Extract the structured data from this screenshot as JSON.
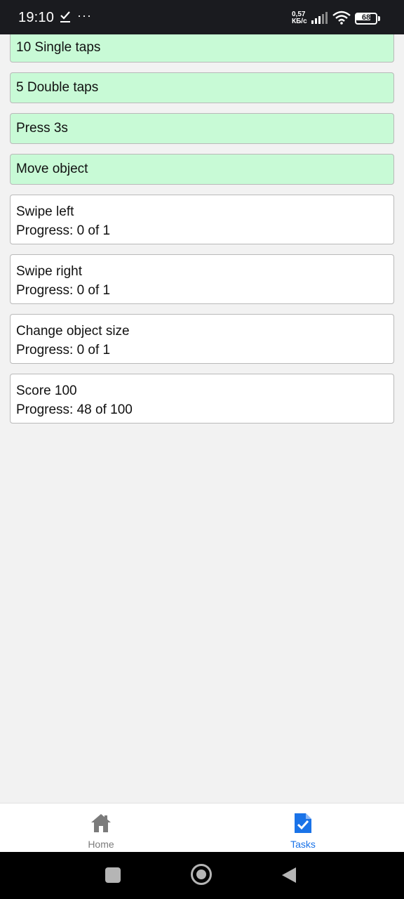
{
  "status_bar": {
    "time": "19:10",
    "check_icon": "download-done-icon",
    "dots": "···",
    "net_speed_value": "0,57",
    "net_speed_unit": "КБ/с",
    "battery": "68"
  },
  "tasks": {
    "completed": [
      {
        "label": "10 Single taps"
      },
      {
        "label": "5 Double taps"
      },
      {
        "label": "Press 3s"
      },
      {
        "label": "Move object"
      }
    ],
    "pending": [
      {
        "label": "Swipe left",
        "progress": "Progress: 0 of 1"
      },
      {
        "label": "Swipe right",
        "progress": "Progress: 0 of 1"
      },
      {
        "label": "Change object size",
        "progress": "Progress: 0 of 1"
      },
      {
        "label": "Score 100",
        "progress": "Progress: 48 of 100"
      }
    ]
  },
  "bottom_nav": {
    "home_label": "Home",
    "tasks_label": "Tasks",
    "home_icon": "home-icon",
    "tasks_icon": "task-document-icon",
    "active": "tasks"
  },
  "colors": {
    "completed_bg": "#c8fad6",
    "active_tab": "#1a73e8",
    "inactive_tab": "#7b7b7b"
  }
}
